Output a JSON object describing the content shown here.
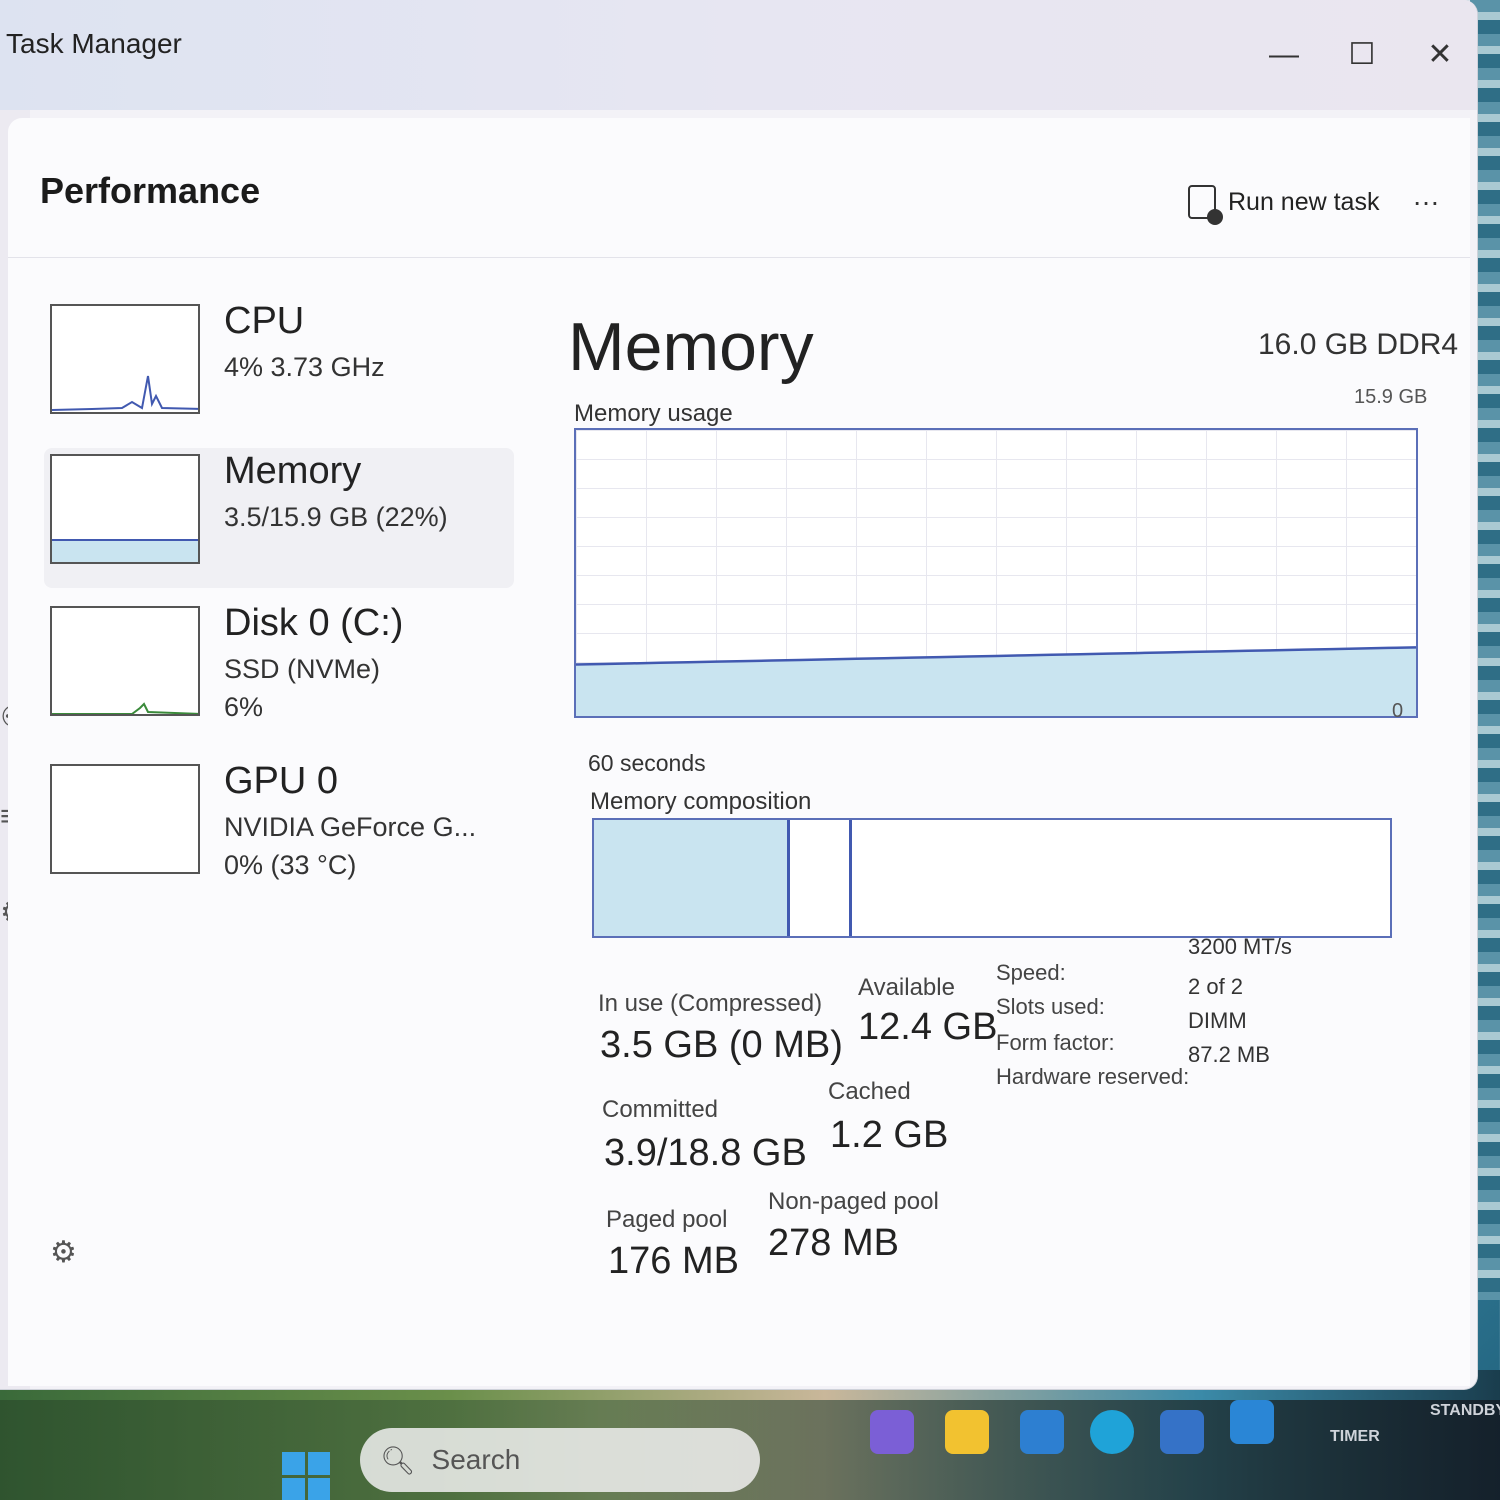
{
  "window": {
    "title": "Task Manager",
    "minimize_glyph": "—",
    "maximize_glyph": "☐",
    "close_glyph": "✕"
  },
  "header": {
    "page_title": "Performance",
    "run_new_task": "Run new task",
    "more_glyph": "…"
  },
  "sidebar": {
    "items": [
      {
        "title": "CPU",
        "sub1": "4% 3.73 GHz",
        "sub2": ""
      },
      {
        "title": "Memory",
        "sub1": "3.5/15.9 GB (22%)",
        "sub2": ""
      },
      {
        "title": "Disk 0 (C:)",
        "sub1": "SSD (NVMe)",
        "sub2": "6%"
      },
      {
        "title": "GPU 0",
        "sub1": "NVIDIA GeForce G...",
        "sub2": "0% (33 °C)"
      }
    ],
    "selected_index": 1
  },
  "memory": {
    "heading": "Memory",
    "spec": "16.0 GB DDR4",
    "usage_label": "Memory usage",
    "usage_max": "15.9 GB",
    "usage_min": "0",
    "seconds_label": "60 seconds",
    "composition_label": "Memory composition",
    "usage_fraction": 0.22,
    "stats": {
      "in_use_label": "In use (Compressed)",
      "in_use_value": "3.5 GB (0 MB)",
      "available_label": "Available",
      "available_value": "12.4 GB",
      "committed_label": "Committed",
      "committed_value": "3.9/18.8 GB",
      "cached_label": "Cached",
      "cached_value": "1.2 GB",
      "paged_label": "Paged pool",
      "paged_value": "176 MB",
      "nonpaged_label": "Non-paged pool",
      "nonpaged_value": "278 MB"
    },
    "specs": {
      "speed_label": "Speed:",
      "speed_value": "3200 MT/s",
      "slots_label": "Slots used:",
      "slots_value": "2 of 2",
      "form_label": "Form factor:",
      "form_value": "DIMM",
      "hw_label": "Hardware reserved:",
      "hw_value": "87.2 MB"
    }
  },
  "taskbar": {
    "search_placeholder": "Search",
    "timer_label": "TIMER",
    "standby_label": "STANDBY"
  },
  "colors": {
    "graph_line": "#4159b0",
    "graph_fill": "#c9e4f0",
    "accent": "#3aa3e8"
  }
}
